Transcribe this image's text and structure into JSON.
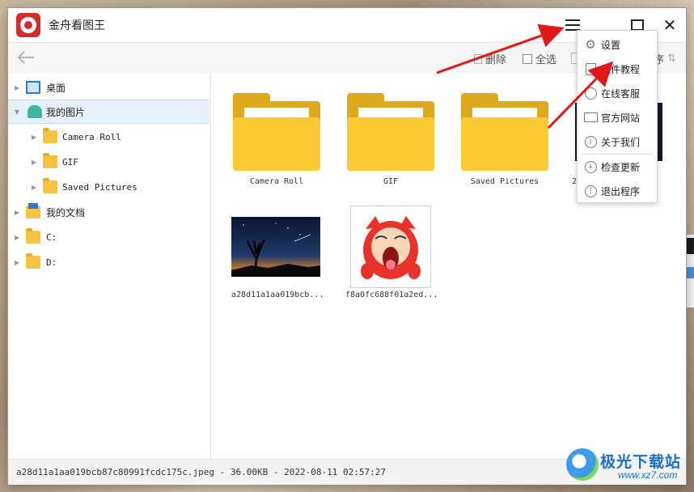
{
  "window": {
    "title": "金舟看图王"
  },
  "toolbar": {
    "delete_label": "删除",
    "select_all_label": "全选",
    "sort_label": "序",
    "sort_symbol": "⇅"
  },
  "sidebar": {
    "items": [
      {
        "label": "桌面",
        "icon": "desktop-icon"
      },
      {
        "label": "我的图片",
        "icon": "pictures-icon"
      },
      {
        "label": "Camera Roll",
        "icon": "folder-icon"
      },
      {
        "label": "GIF",
        "icon": "folder-icon"
      },
      {
        "label": "Saved Pictures",
        "icon": "folder-icon"
      },
      {
        "label": "我的文档",
        "icon": "documents-icon"
      },
      {
        "label": "C:",
        "icon": "folder-icon"
      },
      {
        "label": "D:",
        "icon": "folder-icon"
      }
    ]
  },
  "content": {
    "folders": [
      {
        "label": "Camera Roll"
      },
      {
        "label": "GIF"
      },
      {
        "label": "Saved Pictures"
      }
    ],
    "partial_label": "2",
    "images": [
      {
        "label": "a28d11a1aa019bcb..."
      },
      {
        "label": "f8a0fc688f01a2ed..."
      }
    ]
  },
  "menu": {
    "items": [
      {
        "label": "设置",
        "icon": "gear-icon"
      },
      {
        "label": "软件教程",
        "icon": "book-icon"
      },
      {
        "label": "在线客服",
        "icon": "headset-icon"
      },
      {
        "label": "官方网站",
        "icon": "monitor-icon"
      },
      {
        "label": "关于我们",
        "icon": "info-icon"
      },
      {
        "label": "检查更新",
        "icon": "download-icon"
      },
      {
        "label": "退出程序",
        "icon": "power-icon"
      }
    ]
  },
  "status": {
    "text": "a28d11a1aa019bcb87c80991fcdc175c.jpeg - 36.00KB - 2022-08-11 02:57:27"
  },
  "watermark": {
    "name": "极光下载站",
    "url": "www.xz7.com"
  },
  "colors": {
    "accent": "#d62b2b",
    "folder": "#fcc932",
    "arrow": "#e01818",
    "selection": "#e6f0fb"
  }
}
